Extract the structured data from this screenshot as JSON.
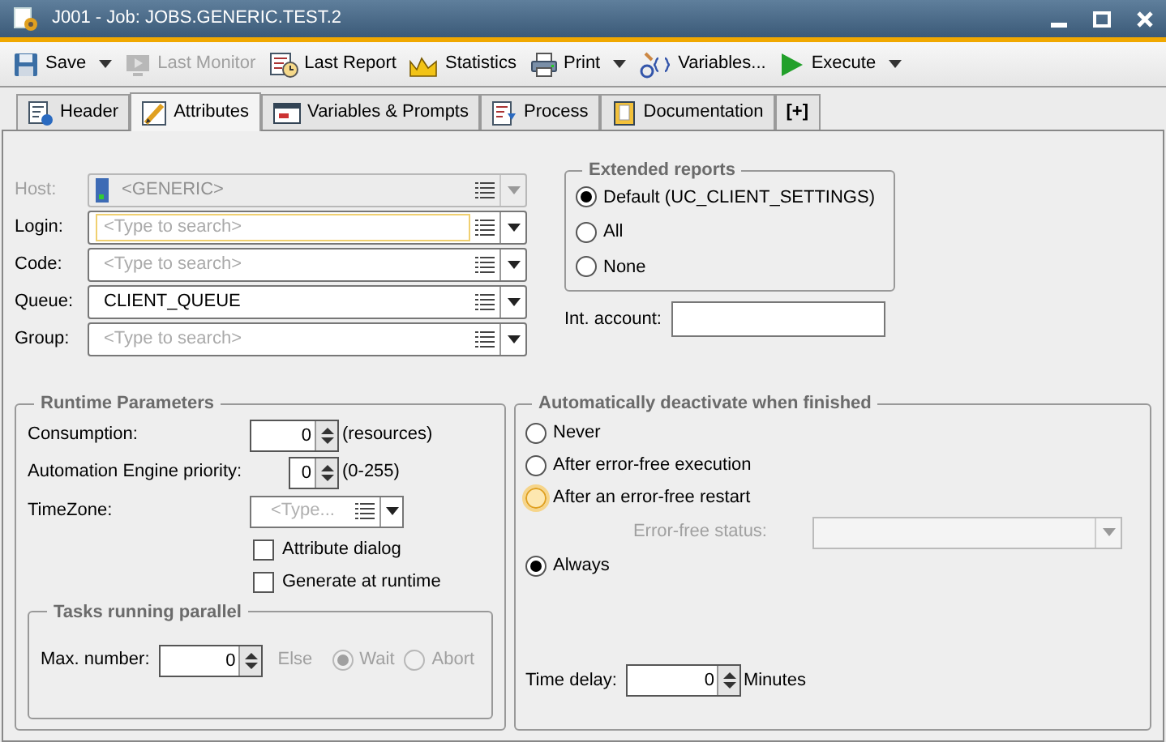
{
  "window": {
    "title": "J001 - Job: JOBS.GENERIC.TEST.2"
  },
  "toolbar": [
    {
      "label": "Save",
      "dropdown": true,
      "disabled": false
    },
    {
      "label": "Last Monitor",
      "dropdown": false,
      "disabled": true
    },
    {
      "label": "Last Report",
      "dropdown": false,
      "disabled": false
    },
    {
      "label": "Statistics",
      "dropdown": false,
      "disabled": false
    },
    {
      "label": "Print",
      "dropdown": true,
      "disabled": false
    },
    {
      "label": "Variables...",
      "dropdown": false,
      "disabled": false
    },
    {
      "label": "Execute",
      "dropdown": true,
      "disabled": false
    }
  ],
  "tabs": [
    {
      "label": "Header",
      "selected": false
    },
    {
      "label": "Attributes",
      "selected": true
    },
    {
      "label": "Variables & Prompts",
      "selected": false
    },
    {
      "label": "Process",
      "selected": false
    },
    {
      "label": "Documentation",
      "selected": false
    },
    {
      "label": "[+]",
      "selected": false
    }
  ],
  "fields": [
    {
      "label": "Host:",
      "value": "<GENERIC>",
      "disabled": true,
      "focused": false
    },
    {
      "label": "Login:",
      "placeholder": "<Type to search>",
      "disabled": false,
      "focused": true
    },
    {
      "label": "Code:",
      "placeholder": "<Type to search>",
      "disabled": false,
      "focused": false
    },
    {
      "label": "Queue:",
      "value": "CLIENT_QUEUE",
      "disabled": false,
      "focused": false
    },
    {
      "label": "Group:",
      "placeholder": "<Type to search>",
      "disabled": false,
      "focused": false
    }
  ],
  "extended_reports": {
    "title": "Extended reports",
    "options": [
      {
        "label": "Default (UC_CLIENT_SETTINGS)",
        "selected": true
      },
      {
        "label": "All",
        "selected": false
      },
      {
        "label": "None",
        "selected": false
      }
    ]
  },
  "int_account": {
    "label": "Int. account:"
  },
  "runtime": {
    "title": "Runtime Parameters",
    "consumption": {
      "label": "Consumption:",
      "value": "0",
      "unit": "(resources)"
    },
    "priority": {
      "label": "Automation Engine priority:",
      "value": "0",
      "unit": "(0-255)"
    },
    "timezone": {
      "label": "TimeZone:",
      "placeholder": "<Type..."
    },
    "checkboxes": [
      {
        "label": "Attribute dialog",
        "checked": false
      },
      {
        "label": "Generate at runtime",
        "checked": false
      }
    ],
    "tasks": {
      "title": "Tasks running parallel",
      "label": "Max. number:",
      "value": "0",
      "else_label": "Else",
      "options": [
        {
          "label": "Wait",
          "selected": true,
          "disabled": true
        },
        {
          "label": "Abort",
          "selected": false,
          "disabled": true
        }
      ]
    }
  },
  "deactivate": {
    "title": "Automatically deactivate when finished",
    "options": [
      {
        "label": "Never",
        "selected": false,
        "focused": false
      },
      {
        "label": "After error-free execution",
        "selected": false,
        "focused": false
      },
      {
        "label": "After an error-free restart",
        "selected": false,
        "focused": true
      },
      {
        "label": "Always",
        "selected": true,
        "focused": false
      }
    ],
    "status": {
      "label": "Error-free status:",
      "disabled": true
    },
    "time_delay": {
      "label": "Time delay:",
      "value": "0",
      "unit": "Minutes"
    }
  }
}
